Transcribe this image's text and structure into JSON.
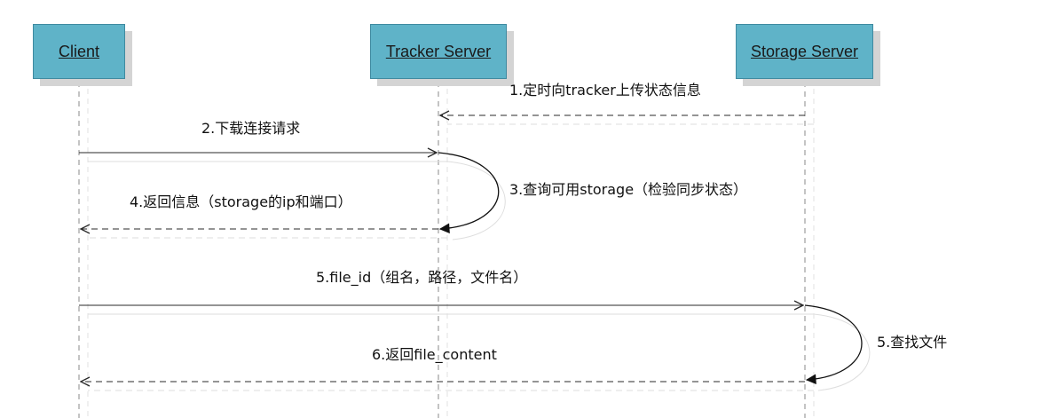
{
  "actors": [
    {
      "id": "client",
      "label": "Client"
    },
    {
      "id": "tracker",
      "label": "Tracker Server"
    },
    {
      "id": "storage",
      "label": "Storage Server"
    }
  ],
  "messages": [
    {
      "id": "m1",
      "label": "1.定时向tracker上传状态信息",
      "from": "storage",
      "to": "tracker",
      "style": "dashed"
    },
    {
      "id": "m2",
      "label": "2.下载连接请求",
      "from": "client",
      "to": "tracker",
      "style": "solid"
    },
    {
      "id": "m3",
      "label": "3.查询可用storage（检验同步状态）",
      "from": "tracker",
      "to": "tracker",
      "style": "self"
    },
    {
      "id": "m4",
      "label": "4.返回信息（storage的ip和端口）",
      "from": "tracker",
      "to": "client",
      "style": "dashed"
    },
    {
      "id": "m5",
      "label": "5.file_id（组名，路径，文件名）",
      "from": "client",
      "to": "storage",
      "style": "solid"
    },
    {
      "id": "m6",
      "label": "5.查找文件",
      "from": "storage",
      "to": "storage",
      "style": "self"
    },
    {
      "id": "m7",
      "label": "6.返回file_content",
      "from": "storage",
      "to": "client",
      "style": "dashed"
    }
  ],
  "colors": {
    "actor_fill": "#5fb3c8",
    "actor_border": "#3f8aa0",
    "lifeline": "#8a8a8a",
    "arrow": "#2a2a2a",
    "shadow": "#d8d8d8"
  }
}
